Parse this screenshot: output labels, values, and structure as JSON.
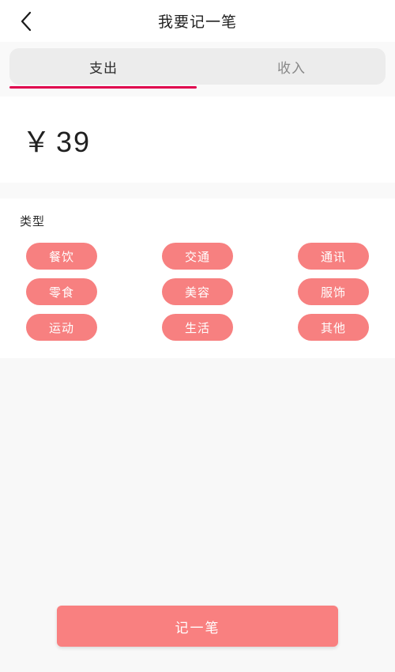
{
  "header": {
    "back_icon": "chevron-left-icon",
    "title": "我要记一笔"
  },
  "tabs": {
    "items": [
      {
        "label": "支出",
        "active": true
      },
      {
        "label": "收入",
        "active": false
      }
    ],
    "active_index": 0,
    "active_underline_color": "#e0004d"
  },
  "amount": {
    "currency_symbol": "￥",
    "value": "39"
  },
  "categories": {
    "label": "类型",
    "chip_color": "#f78080",
    "chip_text_color": "#ffffff",
    "items": [
      {
        "label": "餐饮"
      },
      {
        "label": "交通"
      },
      {
        "label": "通讯"
      },
      {
        "label": "零食"
      },
      {
        "label": "美容"
      },
      {
        "label": "服饰"
      },
      {
        "label": "运动"
      },
      {
        "label": "生活"
      },
      {
        "label": "其他"
      }
    ]
  },
  "submit": {
    "label": "记一笔",
    "color": "#f98080"
  }
}
